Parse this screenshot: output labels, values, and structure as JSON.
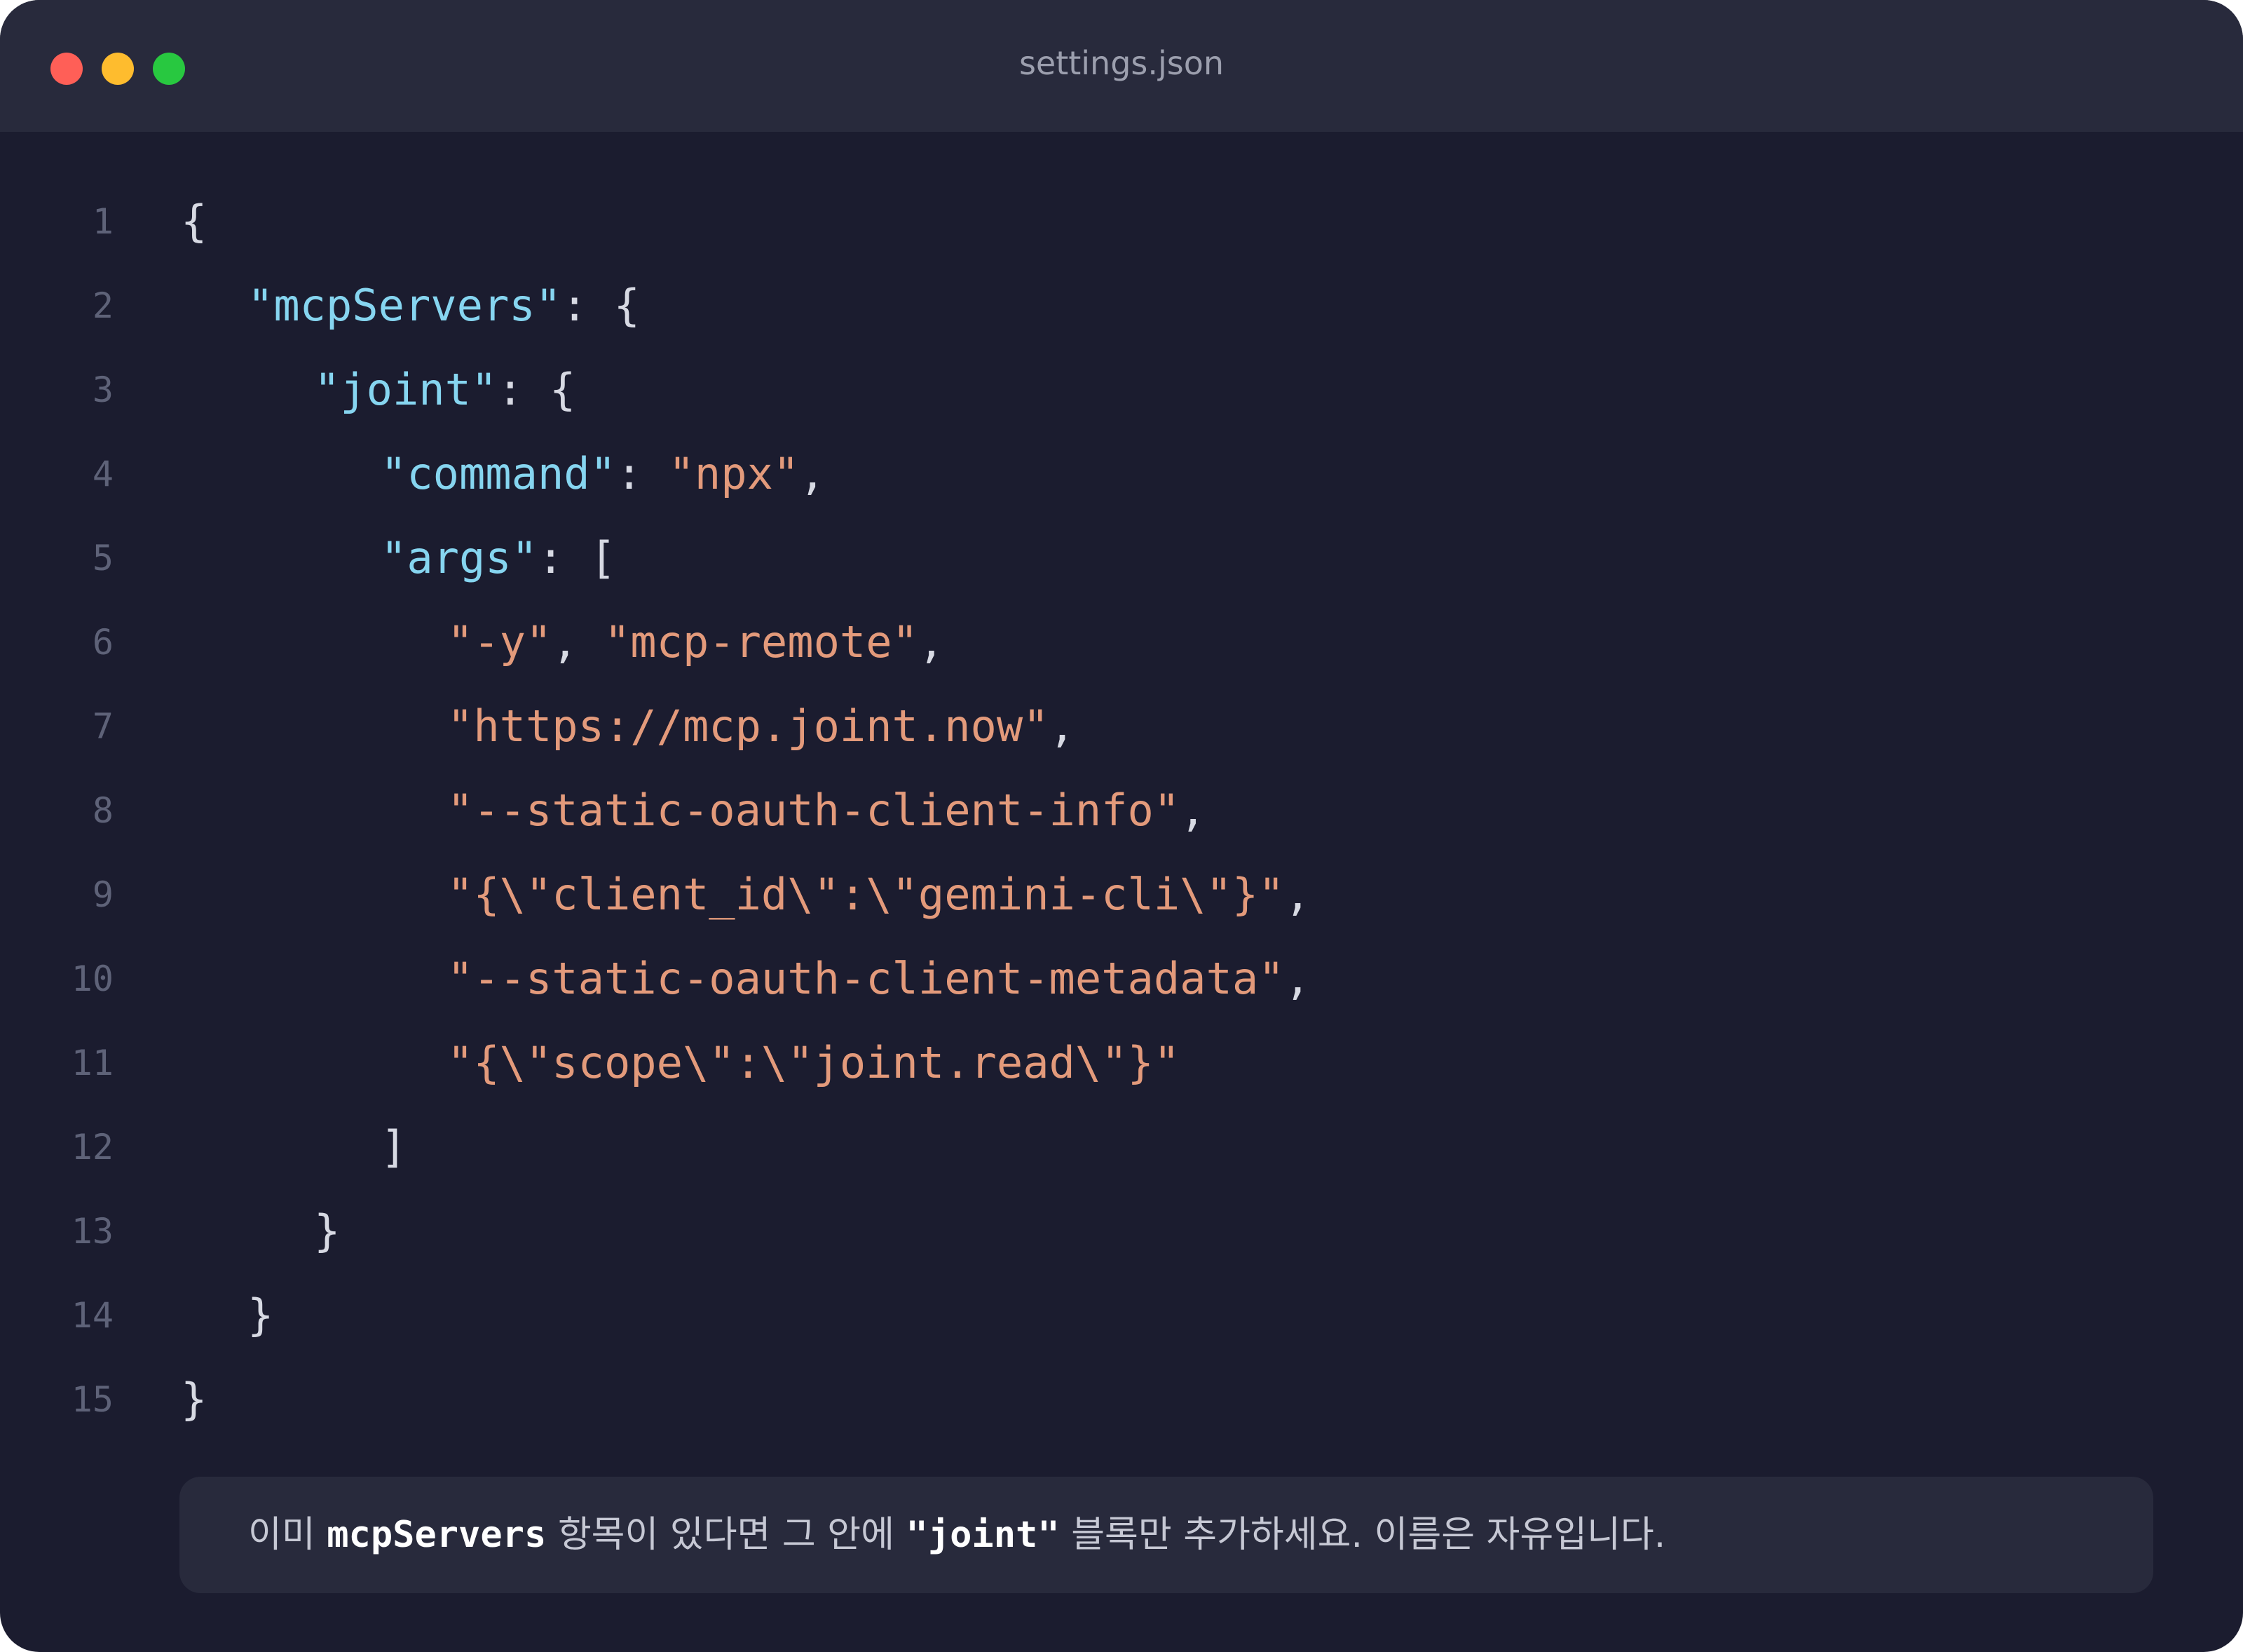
{
  "window": {
    "title": "settings.json",
    "buttons": {
      "close_color": "#ff5f57",
      "minimize_color": "#febc2e",
      "maximize_color": "#28c840"
    }
  },
  "editor": {
    "language": "json",
    "colors": {
      "background": "#1b1c2f",
      "key": "#86d5f0",
      "string": "#e39a7b",
      "punctuation": "#d7d9e3",
      "line_number": "#5e6278"
    },
    "lines": [
      {
        "number": "1",
        "indent": 0,
        "tokens": [
          {
            "t": "punc",
            "v": "{"
          }
        ]
      },
      {
        "number": "2",
        "indent": 1,
        "tokens": [
          {
            "t": "key",
            "v": "\"mcpServers\""
          },
          {
            "t": "punc",
            "v": ": {"
          }
        ]
      },
      {
        "number": "3",
        "indent": 2,
        "tokens": [
          {
            "t": "key",
            "v": "\"joint\""
          },
          {
            "t": "punc",
            "v": ": {"
          }
        ]
      },
      {
        "number": "4",
        "indent": 3,
        "tokens": [
          {
            "t": "key",
            "v": "\"command\""
          },
          {
            "t": "punc",
            "v": ": "
          },
          {
            "t": "str",
            "v": "\"npx\""
          },
          {
            "t": "punc",
            "v": ","
          }
        ]
      },
      {
        "number": "5",
        "indent": 3,
        "tokens": [
          {
            "t": "key",
            "v": "\"args\""
          },
          {
            "t": "punc",
            "v": ": ["
          }
        ]
      },
      {
        "number": "6",
        "indent": 4,
        "tokens": [
          {
            "t": "str",
            "v": "\"-y\""
          },
          {
            "t": "punc",
            "v": ", "
          },
          {
            "t": "str",
            "v": "\"mcp-remote\""
          },
          {
            "t": "punc",
            "v": ","
          }
        ]
      },
      {
        "number": "7",
        "indent": 4,
        "tokens": [
          {
            "t": "str",
            "v": "\"https://mcp.joint.now\""
          },
          {
            "t": "punc",
            "v": ","
          }
        ]
      },
      {
        "number": "8",
        "indent": 4,
        "tokens": [
          {
            "t": "str",
            "v": "\"--static-oauth-client-info\""
          },
          {
            "t": "punc",
            "v": ","
          }
        ]
      },
      {
        "number": "9",
        "indent": 4,
        "tokens": [
          {
            "t": "str",
            "v": "\"{\\\"client_id\\\":\\\"gemini-cli\\\"}\""
          },
          {
            "t": "punc",
            "v": ","
          }
        ]
      },
      {
        "number": "10",
        "indent": 4,
        "tokens": [
          {
            "t": "str",
            "v": "\"--static-oauth-client-metadata\""
          },
          {
            "t": "punc",
            "v": ","
          }
        ]
      },
      {
        "number": "11",
        "indent": 4,
        "tokens": [
          {
            "t": "str",
            "v": "\"{\\\"scope\\\":\\\"joint.read\\\"}\""
          }
        ]
      },
      {
        "number": "12",
        "indent": 3,
        "tokens": [
          {
            "t": "punc",
            "v": "]"
          }
        ]
      },
      {
        "number": "13",
        "indent": 2,
        "tokens": [
          {
            "t": "punc",
            "v": "}"
          }
        ]
      },
      {
        "number": "14",
        "indent": 1,
        "tokens": [
          {
            "t": "punc",
            "v": "}"
          }
        ]
      },
      {
        "number": "15",
        "indent": 0,
        "tokens": [
          {
            "t": "punc",
            "v": "}"
          }
        ]
      }
    ]
  },
  "note": {
    "part1": "이미 ",
    "code1": "mcpServers",
    "part2": " 항목이 있다면 그 안에 ",
    "code2": "\"joint\"",
    "part3": " 블록만 추가하세요. 이름은 자유입니다."
  }
}
